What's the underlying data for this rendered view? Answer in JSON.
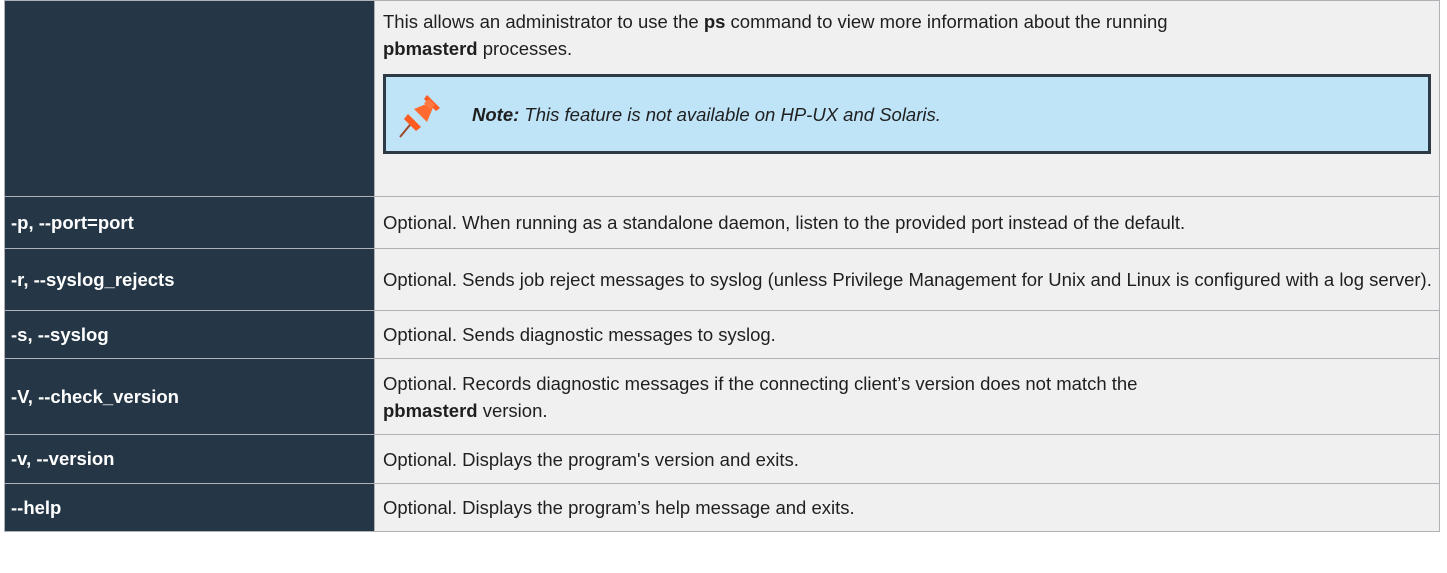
{
  "intro": {
    "line1_before": "This allows an administrator to use the ",
    "line1_bold": "ps",
    "line1_after": " command to view more information about the running",
    "line2_bold": "pbmasterd",
    "line2_after": " processes."
  },
  "note": {
    "label": "Note:",
    "text": " This feature is not available on HP-UX and Solaris.",
    "icon": "pushpin-icon"
  },
  "rows": [
    {
      "option": "-p, --port=port",
      "desc": "Optional. When running as a standalone daemon, listen to the provided port instead of the default."
    },
    {
      "option": "-r, --syslog_rejects",
      "desc": "Optional. Sends job reject messages to syslog (unless Privilege Management for Unix and Linux is configured with a log server)."
    },
    {
      "option": "-s, --syslog",
      "desc": "Optional. Sends diagnostic messages to syslog."
    },
    {
      "option": "-V, --check_version",
      "desc_before": "Optional. Records diagnostic messages if the connecting client’s version does not match the",
      "desc_bold": "pbmasterd",
      "desc_after": " version."
    },
    {
      "option": "-v, --version",
      "desc": "Optional. Displays the program's version and exits."
    },
    {
      "option": "--help",
      "desc": "Optional. Displays the program’s help message and exits."
    }
  ],
  "colors": {
    "option_bg": "#253746",
    "desc_bg": "#f0f0f0",
    "note_bg": "#bfe3f7",
    "pin": "#ff5a1f"
  }
}
